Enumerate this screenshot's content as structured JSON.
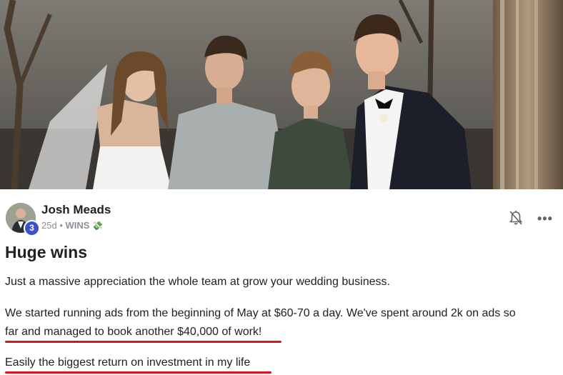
{
  "post": {
    "author": "Josh Meads",
    "level": "3",
    "time": "25d",
    "separator": "•",
    "category": "WINS",
    "category_emoji": "💸",
    "title": "Huge wins",
    "paragraph1": "Just a massive appreciation the whole team at grow your wedding business.",
    "paragraph2_line1": "We started running ads from the beginning of May at $60-70 a day. We've spent around 2k on ads so",
    "paragraph2_line2": "far and managed to book another $40,000 of work!",
    "paragraph3": "Easily the biggest return on investment in my life"
  },
  "actions": {
    "more": "•••"
  },
  "icons": {
    "bell": "bell-off-icon",
    "more": "more-horizontal-icon"
  },
  "colors": {
    "underline": "#d7141f",
    "level_badge": "#3b53c9",
    "muted_text": "#8a8f98"
  }
}
